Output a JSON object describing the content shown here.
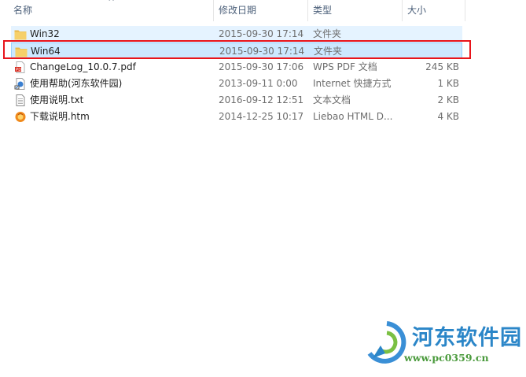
{
  "columns": {
    "name": "名称",
    "date": "修改日期",
    "type": "类型",
    "size": "大小"
  },
  "files": [
    {
      "name": "Win32",
      "date": "2015-09-30 17:14",
      "type": "文件夹",
      "size": "",
      "icon": "folder-icon",
      "state": "hover"
    },
    {
      "name": "Win64",
      "date": "2015-09-30 17:14",
      "type": "文件夹",
      "size": "",
      "icon": "folder-icon",
      "state": "selected"
    },
    {
      "name": "ChangeLog_10.0.7.pdf",
      "date": "2015-09-30 17:06",
      "type": "WPS PDF 文档",
      "size": "245 KB",
      "icon": "pdf-icon",
      "state": ""
    },
    {
      "name": "使用帮助(河东软件园)",
      "date": "2013-09-11 0:00",
      "type": "Internet 快捷方式",
      "size": "1 KB",
      "icon": "internet-shortcut-icon",
      "state": ""
    },
    {
      "name": "使用说明.txt",
      "date": "2016-09-12 12:51",
      "type": "文本文档",
      "size": "2 KB",
      "icon": "text-document-icon",
      "state": ""
    },
    {
      "name": "下载说明.htm",
      "date": "2014-12-25 10:17",
      "type": "Liebao HTML D...",
      "size": "4 KB",
      "icon": "liebao-html-icon",
      "state": ""
    }
  ],
  "watermark": {
    "title": "河东软件园",
    "url": "www.pc0359.cn"
  },
  "colors": {
    "selection_bg": "#cce8ff",
    "highlight_border": "#e8141b",
    "folder": "#f6d06a"
  }
}
